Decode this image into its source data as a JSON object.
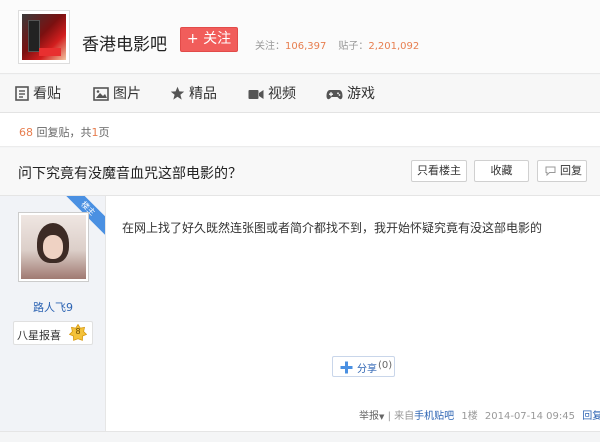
{
  "forum": {
    "name": "香港电影吧",
    "follow_label": "+ 关注",
    "followers_label": "关注：",
    "followers": "106,397",
    "posts_label": "贴子：",
    "posts": "2,201,092"
  },
  "tabs": [
    {
      "label": "看贴",
      "icon": "document-icon"
    },
    {
      "label": "图片",
      "icon": "picture-icon"
    },
    {
      "label": "精品",
      "icon": "star-icon"
    },
    {
      "label": "视频",
      "icon": "video-icon"
    },
    {
      "label": "游戏",
      "icon": "gamepad-icon"
    }
  ],
  "thread": {
    "reply_count": "68",
    "reply_label": "回复贴，共",
    "page_count": "1",
    "page_label": "页",
    "title": "问下究竟有没魔音血咒这部电影的？",
    "buttons": {
      "only_op": "只看楼主",
      "collect": "收藏",
      "reply": "回复"
    }
  },
  "post": {
    "badge": "楼主",
    "author": "路人飞9",
    "level_name": "八星报喜",
    "level": "8",
    "content": "在网上找了好久既然连张图或者简介都找不到，我开始怀疑究竟有没这部电影的",
    "share_label": "分享",
    "share_count": "(0)",
    "report_label": "举报",
    "source_prefix": "来自",
    "source": "手机贴吧",
    "floor": "1楼",
    "time": "2014-07-14 09:45",
    "reply_label": "回复"
  },
  "colors": {
    "accent_red": "#f15d5b",
    "link_blue": "#2d64b3",
    "number_orange": "#e77e4f"
  }
}
